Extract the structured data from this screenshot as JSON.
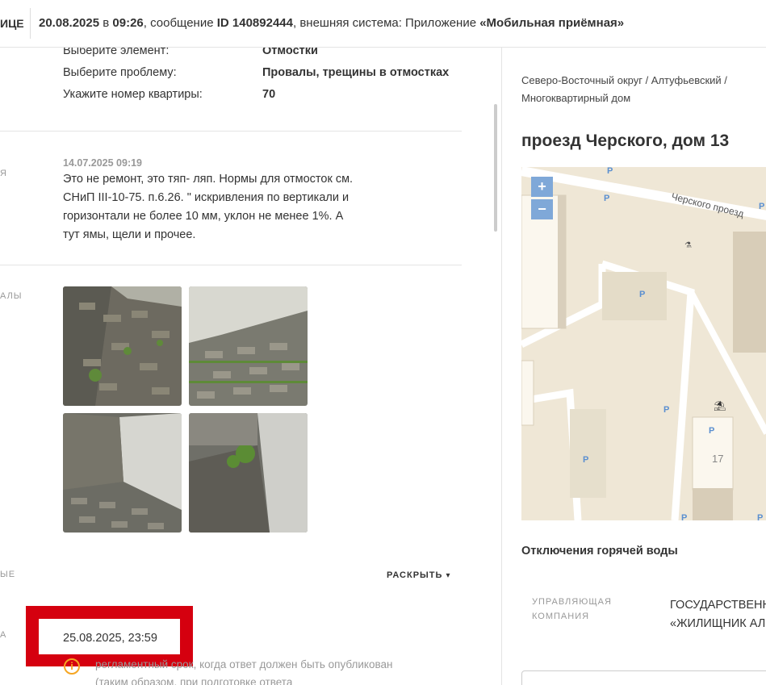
{
  "header": {
    "crumb_left": "ИЦЕ",
    "date": "20.08.2025",
    "sep_in": " в ",
    "time": "09:26",
    "msg_prefix": ", сообщение ",
    "id": "ID 140892444",
    "ext_prefix": ", внешняя система: Приложение ",
    "app": "«Мобильная приёмная»"
  },
  "details": [
    {
      "label": "Выберите элемент:",
      "value": "Отмостки"
    },
    {
      "label": "Выберите проблему:",
      "value": "Провалы, трещины в отмостках"
    },
    {
      "label": "Укажите номер квартиры:",
      "value": "70"
    }
  ],
  "side_labels": {
    "comment": "Я",
    "materials": "АЛЫ",
    "additional": "ЫЕ",
    "deadline": "А"
  },
  "comment": {
    "date": "14.07.2025 09:19",
    "text": "Это не ремонт, это тяп- ляп. Нормы для отмосток см. СНиП III-10-75. п.6.26. \" искривления по вертикали и горизонтали не более 10 мм, уклон не менее 1%. А тут ямы, щели и прочее."
  },
  "photos": [
    "photo-1",
    "photo-2",
    "photo-3",
    "photo-4"
  ],
  "expand": {
    "label": "РАСКРЫТЬ",
    "icon": "chevron-down-icon"
  },
  "deadline": {
    "value": "25.08.2025, 23:59",
    "note": "регламентный срок, когда ответ должен быть опубликован (таким образом, при подготовке ответа"
  },
  "right": {
    "breadcrumb": "Северо-Восточный округ / Алтуфьевский / Многоквартирный дом",
    "title": "проезд Черского, дом 13",
    "map": {
      "street_label": "Черского проезд",
      "zoom_in": "+",
      "zoom_out": "−",
      "building_number": "17",
      "parking_marker": "P"
    },
    "hot_water": "Отключения горячей воды",
    "mc_label": "УПРАВЛЯЮЩАЯ КОМПАНИЯ",
    "mc_value_1": "ГОСУДАРСТВЕНН",
    "mc_value_2": "«ЖИЛИЩНИК АЛ"
  },
  "colors": {
    "accent_red": "#d5000f",
    "warning": "#f5a623",
    "map_bg": "#efe7d6",
    "zoom": "#7fa8d8"
  }
}
